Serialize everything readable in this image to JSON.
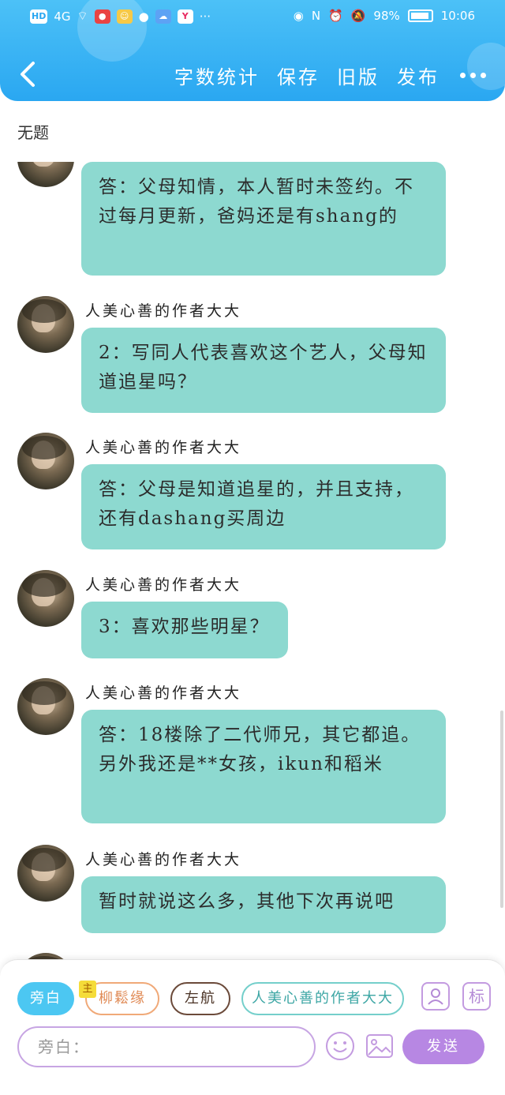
{
  "status_bar": {
    "left": [
      "HD",
      "4G"
    ],
    "battery_percent": "98%",
    "time": "10:06"
  },
  "header": {
    "actions": [
      "字数统计",
      "保存",
      "旧版",
      "发布"
    ]
  },
  "title": "无题",
  "messages": [
    {
      "sender": "",
      "text": "答：父母知情，本人暂时未签约。不过每月更新，爸妈还是有shang的"
    },
    {
      "sender": "人美心善的作者大大",
      "text": "2：写同人代表喜欢这个艺人，父母知道追星吗？"
    },
    {
      "sender": "人美心善的作者大大",
      "text": "答：父母是知道追星的，并且支持，还有dashang买周边"
    },
    {
      "sender": "人美心善的作者大大",
      "text": "3：喜欢那些明星？"
    },
    {
      "sender": "人美心善的作者大大",
      "text": "答：18楼除了二代师兄，其它都追。另外我还是**女孩，ikun和稻米"
    },
    {
      "sender": "人美心善的作者大大",
      "text": "暂时就说这么多，其他下次再说吧"
    }
  ],
  "composer": {
    "chips": {
      "aside": "旁白",
      "badge": "主",
      "role1": "柳鬆缘",
      "role2": "左航",
      "role3": "人美心善的作者大大"
    },
    "tag_label": "标",
    "input_value": "旁白：",
    "send_label": "发送"
  },
  "colors": {
    "header": "#2aa7f1",
    "bubble": "#8dd9d0",
    "send": "#b787e3"
  }
}
